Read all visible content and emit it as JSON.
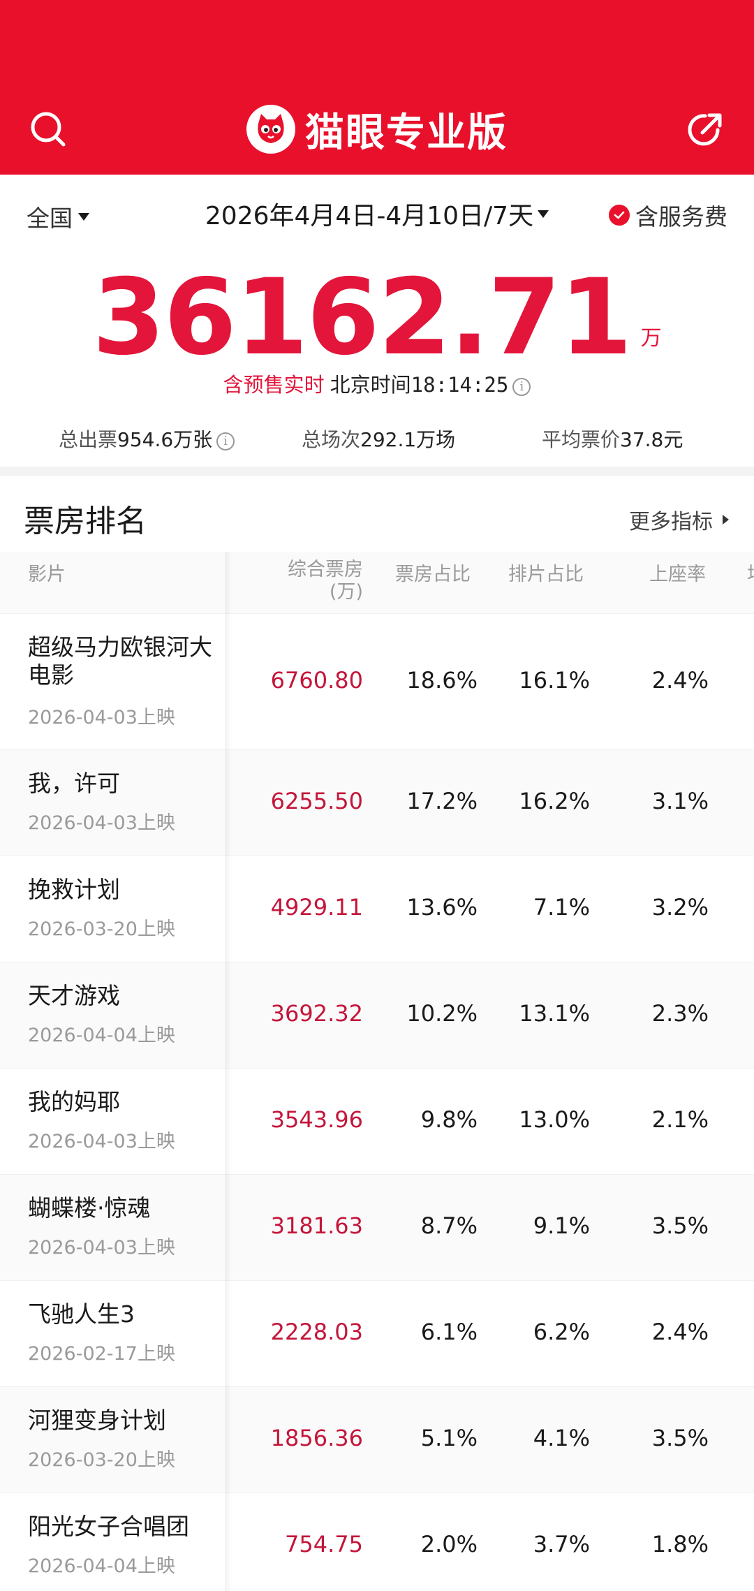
{
  "app": {
    "brand": "猫眼专业版"
  },
  "filter": {
    "region": "全国",
    "date_range": "2026年4月4日-4月10日/7天",
    "service_fee": "含服务费"
  },
  "summary": {
    "total": "36162.71",
    "unit": "万",
    "presale_label": "含预售实时",
    "beijing_label": "北京时间",
    "time": "18:14:25"
  },
  "stats": {
    "tickets_label": "总出票",
    "tickets_value": "954.6万张",
    "shows_label": "总场次",
    "shows_value": "292.1万场",
    "avg_price_label": "平均票价",
    "avg_price_value": "37.8元"
  },
  "ranking": {
    "title": "票房排名",
    "more_label": "更多指标",
    "columns": {
      "film": "影片",
      "boxoffice": "综合票房",
      "boxoffice_unit": "(万)",
      "share": "票房占比",
      "schedule": "排片占比",
      "seat_rate": "上座率",
      "truncated": "场"
    },
    "rows": [
      {
        "name": "超级马力欧银河大电影",
        "release": "2026-04-03上映",
        "boxoffice": "6760.80",
        "share": "18.6%",
        "schedule": "16.1%",
        "seat_rate": "2.4%"
      },
      {
        "name": "我，许可",
        "release": "2026-04-03上映",
        "boxoffice": "6255.50",
        "share": "17.2%",
        "schedule": "16.2%",
        "seat_rate": "3.1%"
      },
      {
        "name": "挽救计划",
        "release": "2026-03-20上映",
        "boxoffice": "4929.11",
        "share": "13.6%",
        "schedule": "7.1%",
        "seat_rate": "3.2%"
      },
      {
        "name": "天才游戏",
        "release": "2026-04-04上映",
        "boxoffice": "3692.32",
        "share": "10.2%",
        "schedule": "13.1%",
        "seat_rate": "2.3%"
      },
      {
        "name": "我的妈耶",
        "release": "2026-04-03上映",
        "boxoffice": "3543.96",
        "share": "9.8%",
        "schedule": "13.0%",
        "seat_rate": "2.1%"
      },
      {
        "name": "蝴蝶楼·惊魂",
        "release": "2026-04-03上映",
        "boxoffice": "3181.63",
        "share": "8.7%",
        "schedule": "9.1%",
        "seat_rate": "3.5%"
      },
      {
        "name": "飞驰人生3",
        "release": "2026-02-17上映",
        "boxoffice": "2228.03",
        "share": "6.1%",
        "schedule": "6.2%",
        "seat_rate": "2.4%"
      },
      {
        "name": "河狸变身计划",
        "release": "2026-03-20上映",
        "boxoffice": "1856.36",
        "share": "5.1%",
        "schedule": "4.1%",
        "seat_rate": "3.5%"
      },
      {
        "name": "阳光女子合唱团",
        "release": "2026-04-04上映",
        "boxoffice": "754.75",
        "share": "2.0%",
        "schedule": "3.7%",
        "seat_rate": "1.8%"
      }
    ]
  },
  "colors": {
    "brand_red": "#e8102b",
    "value_red": "#c4153a",
    "muted": "#9a9a9a"
  },
  "icons": {
    "search": "search-icon",
    "share": "share-icon",
    "logo": "cat-logo-icon",
    "check": "check-circle-icon"
  }
}
